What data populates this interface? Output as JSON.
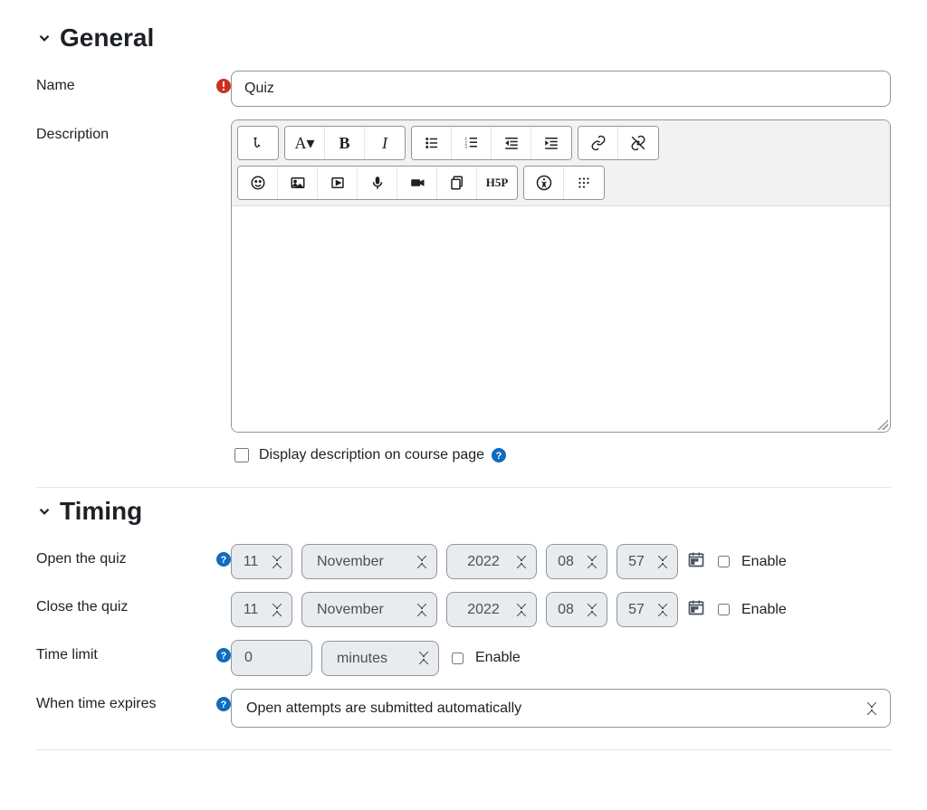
{
  "sections": {
    "general": {
      "title": "General",
      "name_label": "Name",
      "name_value": "Quiz",
      "description_label": "Description",
      "display_desc_label": "Display description on course page"
    },
    "timing": {
      "title": "Timing",
      "open_label": "Open the quiz",
      "close_label": "Close the quiz",
      "timelimit_label": "Time limit",
      "expires_label": "When time expires",
      "enable_label": "Enable",
      "open_date": {
        "day": "11",
        "month": "November",
        "year": "2022",
        "hour": "08",
        "minute": "57"
      },
      "close_date": {
        "day": "11",
        "month": "November",
        "year": "2022",
        "hour": "08",
        "minute": "57"
      },
      "timelimit_value": "0",
      "timelimit_unit": "minutes",
      "expires_value": "Open attempts are submitted automatically"
    }
  }
}
